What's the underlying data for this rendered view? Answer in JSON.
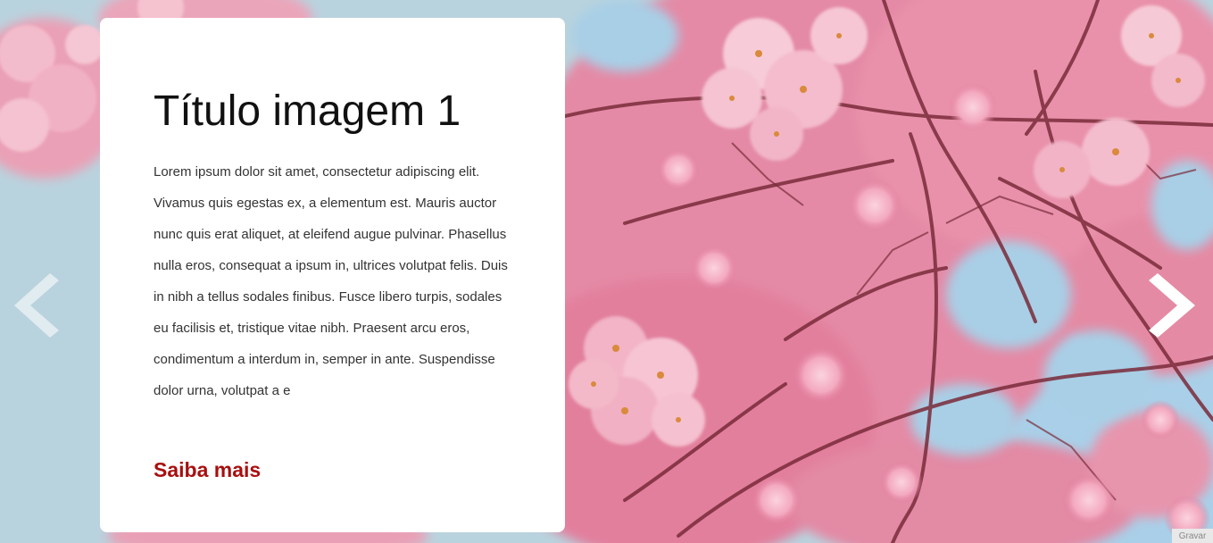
{
  "slide": {
    "title": "Título imagem 1",
    "body": "Lorem ipsum dolor sit amet, consectetur adipiscing elit. Vivamus quis egestas ex, a elementum est. Mauris auctor nunc quis erat aliquet, at eleifend augue pulvinar. Phasellus nulla eros, consequat a ipsum in, ultrices volutpat felis. Duis in nibh a tellus sodales finibus. Fusce libero turpis, sodales eu facilisis et, tristique vitae nibh. Praesent arcu eros, condimentum a interdum in, semper in ante. Suspendisse dolor urna, volutpat a e",
    "link_label": "Saiba mais",
    "background_image": "cherry-blossom-photo"
  },
  "controls": {
    "prev_icon": "chevron-left-icon",
    "next_icon": "chevron-right-icon"
  },
  "overlay_badge": "Gravar",
  "colors": {
    "sky": "#b9d3de",
    "blossom": "#e37c9c",
    "link": "#a80f0f",
    "card_bg": "#ffffff",
    "arrow_prev": "#e6eef2",
    "arrow_next": "#ffffff"
  }
}
